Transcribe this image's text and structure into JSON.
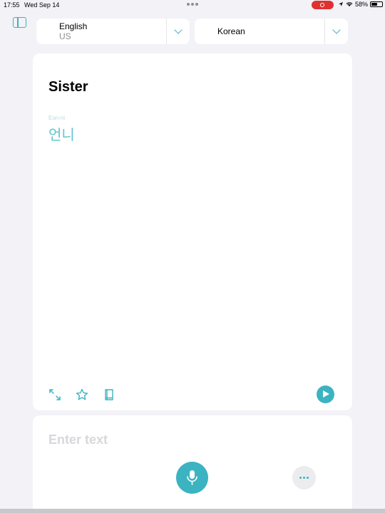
{
  "status_bar": {
    "time": "17:55",
    "date": "Wed Sep 14",
    "battery": "58%",
    "battery_level": 0.58
  },
  "languages": {
    "source": {
      "name": "English",
      "variant": "US"
    },
    "target": {
      "name": "Korean"
    }
  },
  "translation": {
    "source_text": "Sister",
    "romanization": "Eon-ni",
    "translated_text": "언니"
  },
  "card_actions": {
    "expand_icon": "expand-icon",
    "favorite_icon": "star-icon",
    "dictionary_icon": "book-icon",
    "play_icon": "play-icon"
  },
  "input": {
    "placeholder": "Enter text",
    "value": ""
  },
  "colors": {
    "accent": "#3cb3c1",
    "background": "#f2f2f7",
    "record": "#e0312f"
  }
}
